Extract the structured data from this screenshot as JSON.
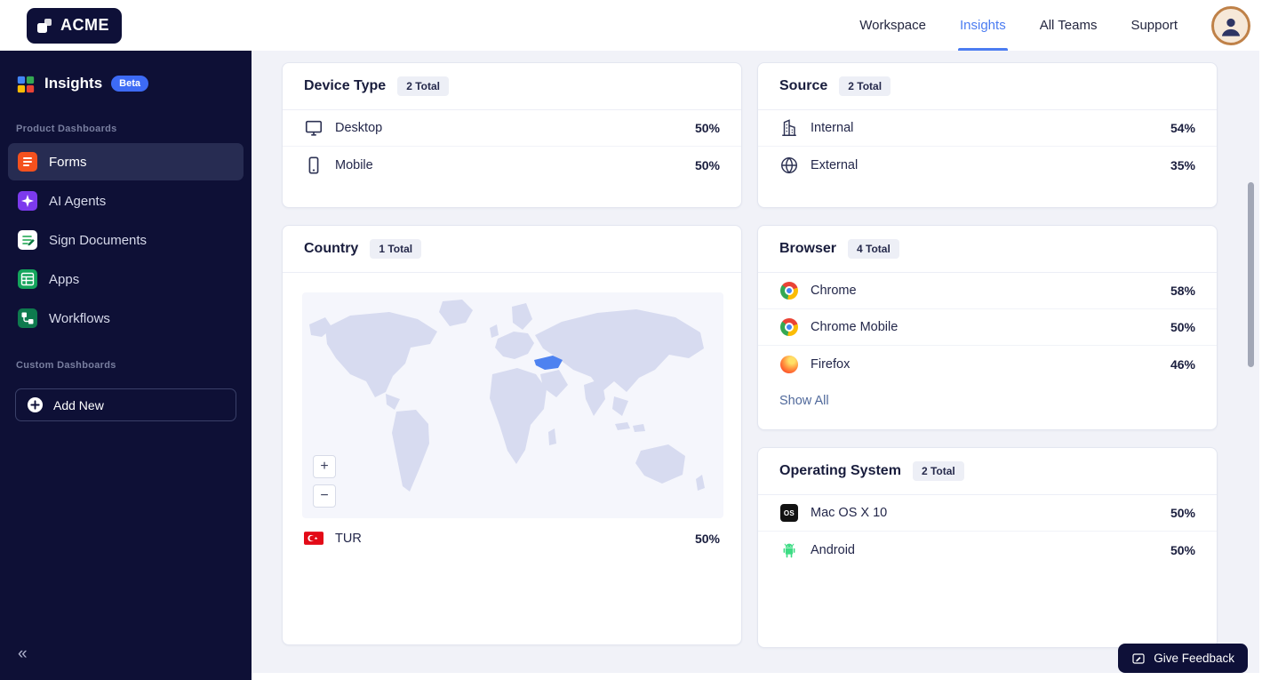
{
  "header": {
    "logo": "ACME",
    "nav_items": [
      {
        "label": "Workspace",
        "active": false
      },
      {
        "label": "Insights",
        "active": true
      },
      {
        "label": "All Teams",
        "active": false
      },
      {
        "label": "Support",
        "active": false
      }
    ]
  },
  "sidebar": {
    "brand": {
      "title": "Insights",
      "badge": "Beta",
      "icon": "insights-logo-icon"
    },
    "sections": [
      {
        "label": "Product Dashboards",
        "items": [
          {
            "label": "Forms",
            "icon": "forms-icon",
            "active": true
          },
          {
            "label": "AI Agents",
            "icon": "ai-agents-icon",
            "active": false
          },
          {
            "label": "Sign Documents",
            "icon": "sign-documents-icon",
            "active": false
          },
          {
            "label": "Apps",
            "icon": "apps-icon",
            "active": false
          },
          {
            "label": "Workflows",
            "icon": "workflows-icon",
            "active": false
          }
        ]
      },
      {
        "label": "Custom Dashboards",
        "items": []
      }
    ],
    "add_new": "Add New",
    "collapse": "«"
  },
  "cards": {
    "device_type": {
      "title": "Device Type",
      "badge": "2 Total",
      "rows": [
        {
          "label": "Desktop",
          "value": "50%",
          "icon": "desktop-icon"
        },
        {
          "label": "Mobile",
          "value": "50%",
          "icon": "mobile-icon"
        }
      ]
    },
    "source": {
      "title": "Source",
      "badge": "2 Total",
      "rows": [
        {
          "label": "Internal",
          "value": "54%",
          "icon": "building-icon"
        },
        {
          "label": "External",
          "value": "35%",
          "icon": "globe-icon"
        }
      ]
    },
    "country": {
      "title": "Country",
      "badge": "1 Total",
      "zoom_in": "+",
      "zoom_out": "−",
      "highlighted_country": "Turkey",
      "rows": [
        {
          "label": "TUR",
          "value": "50%",
          "icon": "turkey-flag-icon"
        }
      ]
    },
    "browser": {
      "title": "Browser",
      "badge": "4 Total",
      "rows": [
        {
          "label": "Chrome",
          "value": "58%",
          "icon": "chrome-icon"
        },
        {
          "label": "Chrome Mobile",
          "value": "50%",
          "icon": "chrome-icon"
        },
        {
          "label": "Firefox",
          "value": "46%",
          "icon": "firefox-icon"
        }
      ],
      "show_all": "Show All"
    },
    "operating_system": {
      "title": "Operating System",
      "badge": "2 Total",
      "rows": [
        {
          "label": "Mac OS X 10",
          "value": "50%",
          "icon": "macos-icon",
          "icon_text": "OS"
        },
        {
          "label": "Android",
          "value": "50%",
          "icon": "android-icon"
        }
      ]
    }
  },
  "feedback": {
    "label": "Give Feedback"
  }
}
